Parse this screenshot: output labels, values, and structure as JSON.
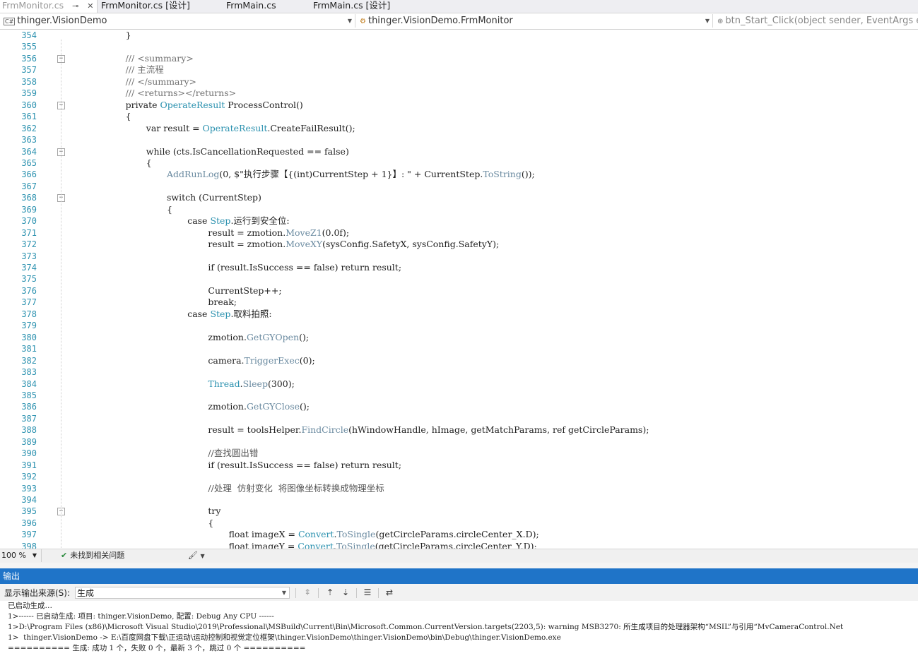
{
  "tabs": [
    {
      "label": "FrmMonitor.cs",
      "active": true
    },
    {
      "label": "FrmMonitor.cs [设计]",
      "active": false
    },
    {
      "label": "FrmMain.cs",
      "active": false
    },
    {
      "label": "FrmMain.cs [设计]",
      "active": false
    }
  ],
  "nav": {
    "project": "thinger.VisionDemo",
    "project_icon": "C#",
    "class_name": "thinger.VisionDemo.FrmMonitor",
    "member": "btn_Start_Click(object sender, EventArgs e)"
  },
  "editor": {
    "lines": [
      {
        "n": "354",
        "indent": 12,
        "segs": [
          [
            "}",
            "kw"
          ]
        ]
      },
      {
        "n": "355",
        "indent": 0,
        "segs": []
      },
      {
        "n": "356",
        "indent": 12,
        "segs": [
          [
            "/// <summary>",
            "cmt"
          ]
        ]
      },
      {
        "n": "357",
        "indent": 12,
        "segs": [
          [
            "/// 主流程",
            "cmt"
          ]
        ]
      },
      {
        "n": "358",
        "indent": 12,
        "segs": [
          [
            "/// </summary>",
            "cmt"
          ]
        ]
      },
      {
        "n": "359",
        "indent": 12,
        "segs": [
          [
            "/// <returns></returns>",
            "cmt"
          ]
        ]
      },
      {
        "n": "360",
        "indent": 12,
        "segs": [
          [
            "private ",
            "kw"
          ],
          [
            "OperateResult",
            "type"
          ],
          [
            " ProcessControl()",
            "kw"
          ]
        ]
      },
      {
        "n": "361",
        "indent": 12,
        "segs": [
          [
            "{",
            "kw"
          ]
        ]
      },
      {
        "n": "362",
        "indent": 16,
        "segs": [
          [
            "var result = ",
            "kw"
          ],
          [
            "OperateResult",
            "type"
          ],
          [
            ".CreateFailResult();",
            "kw"
          ]
        ]
      },
      {
        "n": "363",
        "indent": 0,
        "segs": []
      },
      {
        "n": "364",
        "indent": 16,
        "segs": [
          [
            "while (cts.IsCancellationRequested == false)",
            "kw"
          ]
        ]
      },
      {
        "n": "365",
        "indent": 16,
        "segs": [
          [
            "{",
            "kw"
          ]
        ]
      },
      {
        "n": "366",
        "indent": 20,
        "segs": [
          [
            "AddRunLog",
            "meth"
          ],
          [
            "(0, $\"执行步骤【{(int)CurrentStep + 1}】: \" + CurrentStep.",
            "kw"
          ],
          [
            "ToString",
            "meth"
          ],
          [
            "());",
            "kw"
          ]
        ]
      },
      {
        "n": "367",
        "indent": 0,
        "segs": []
      },
      {
        "n": "368",
        "indent": 20,
        "segs": [
          [
            "switch (CurrentStep)",
            "kw"
          ]
        ]
      },
      {
        "n": "369",
        "indent": 20,
        "segs": [
          [
            "{",
            "kw"
          ]
        ]
      },
      {
        "n": "370",
        "indent": 24,
        "segs": [
          [
            "case ",
            "kw"
          ],
          [
            "Step",
            "type"
          ],
          [
            ".运行到安全位:",
            "kw"
          ]
        ]
      },
      {
        "n": "371",
        "indent": 28,
        "segs": [
          [
            "result = zmotion.",
            "kw"
          ],
          [
            "MoveZ1",
            "meth"
          ],
          [
            "(0.0f);",
            "kw"
          ]
        ]
      },
      {
        "n": "372",
        "indent": 28,
        "segs": [
          [
            "result = zmotion.",
            "kw"
          ],
          [
            "MoveXY",
            "meth"
          ],
          [
            "(sysConfig.SafetyX, sysConfig.SafetyY);",
            "kw"
          ]
        ]
      },
      {
        "n": "373",
        "indent": 0,
        "segs": []
      },
      {
        "n": "374",
        "indent": 28,
        "segs": [
          [
            "if (result.IsSuccess == false) return result;",
            "kw"
          ]
        ]
      },
      {
        "n": "375",
        "indent": 0,
        "segs": []
      },
      {
        "n": "376",
        "indent": 28,
        "segs": [
          [
            "CurrentStep++;",
            "kw"
          ]
        ]
      },
      {
        "n": "377",
        "indent": 28,
        "segs": [
          [
            "break;",
            "kw"
          ]
        ]
      },
      {
        "n": "378",
        "indent": 24,
        "segs": [
          [
            "case ",
            "kw"
          ],
          [
            "Step",
            "type"
          ],
          [
            ".取料拍照:",
            "kw"
          ]
        ]
      },
      {
        "n": "379",
        "indent": 0,
        "segs": []
      },
      {
        "n": "380",
        "indent": 28,
        "segs": [
          [
            "zmotion.",
            "kw"
          ],
          [
            "GetGYOpen",
            "meth"
          ],
          [
            "();",
            "kw"
          ]
        ]
      },
      {
        "n": "381",
        "indent": 0,
        "segs": []
      },
      {
        "n": "382",
        "indent": 28,
        "segs": [
          [
            "camera.",
            "kw"
          ],
          [
            "TriggerExec",
            "meth"
          ],
          [
            "(0);",
            "kw"
          ]
        ]
      },
      {
        "n": "383",
        "indent": 0,
        "segs": []
      },
      {
        "n": "384",
        "indent": 28,
        "segs": [
          [
            "Thread",
            "type"
          ],
          [
            ".",
            "kw"
          ],
          [
            "Sleep",
            "meth"
          ],
          [
            "(300);",
            "kw"
          ]
        ]
      },
      {
        "n": "385",
        "indent": 0,
        "segs": []
      },
      {
        "n": "386",
        "indent": 28,
        "segs": [
          [
            "zmotion.",
            "kw"
          ],
          [
            "GetGYClose",
            "meth"
          ],
          [
            "();",
            "kw"
          ]
        ]
      },
      {
        "n": "387",
        "indent": 0,
        "segs": []
      },
      {
        "n": "388",
        "indent": 28,
        "segs": [
          [
            "result = toolsHelper.",
            "kw"
          ],
          [
            "FindCircle",
            "meth"
          ],
          [
            "(hWindowHandle, hImage, getMatchParams, ref getCircleParams);",
            "kw"
          ]
        ]
      },
      {
        "n": "389",
        "indent": 0,
        "segs": []
      },
      {
        "n": "390",
        "indent": 28,
        "segs": [
          [
            "//查找圆出错",
            "cmtg"
          ]
        ]
      },
      {
        "n": "391",
        "indent": 28,
        "segs": [
          [
            "if (result.IsSuccess == false) return result;",
            "kw"
          ]
        ]
      },
      {
        "n": "392",
        "indent": 0,
        "segs": []
      },
      {
        "n": "393",
        "indent": 28,
        "segs": [
          [
            "//处理  仿射变化  将图像坐标转换成物理坐标",
            "cmtg"
          ]
        ]
      },
      {
        "n": "394",
        "indent": 0,
        "segs": []
      },
      {
        "n": "395",
        "indent": 28,
        "segs": [
          [
            "try",
            "kw"
          ]
        ]
      },
      {
        "n": "396",
        "indent": 28,
        "segs": [
          [
            "{",
            "kw"
          ]
        ]
      },
      {
        "n": "397",
        "indent": 32,
        "segs": [
          [
            "float imageX = ",
            "kw"
          ],
          [
            "Convert",
            "type"
          ],
          [
            ".",
            "kw"
          ],
          [
            "ToSingle",
            "meth"
          ],
          [
            "(getCircleParams.circleCenter_X.D);",
            "kw"
          ]
        ]
      },
      {
        "n": "398",
        "indent": 32,
        "segs": [
          [
            "float imageY = ",
            "kw"
          ],
          [
            "Convert",
            "type"
          ],
          [
            ".",
            "kw"
          ],
          [
            "ToSingle",
            "meth"
          ],
          [
            "(getCircleParams.circleCenter_Y.D);",
            "kw"
          ]
        ]
      }
    ]
  },
  "status": {
    "zoom": "100 %",
    "issues": "未找到相关问题"
  },
  "output": {
    "title": "输出",
    "source_label": "显示输出来源(S):",
    "source_value": "生成",
    "lines": [
      "已启动生成…",
      "1>------ 已启动生成: 项目: thinger.VisionDemo, 配置: Debug Any CPU ------",
      "1>D:\\Program Files (x86)\\Microsoft Visual Studio\\2019\\Professional\\MSBuild\\Current\\Bin\\Microsoft.Common.CurrentVersion.targets(2203,5): warning MSB3270: 所生成项目的处理器架构“MSIL”与引用“MvCameraControl.Net",
      "1>  thinger.VisionDemo -> E:\\百度网盘下载\\正运动\\运动控制和视觉定位框架\\thinger.VisionDemo\\thinger.VisionDemo\\bin\\Debug\\thinger.VisionDemo.exe",
      "========== 生成: 成功 1 个，失败 0 个，最新 3 个，跳过 0 个 =========="
    ]
  },
  "colors": {
    "output_header": "#1f74c8",
    "line_number": "#2b91af",
    "type_name": "#2b91af"
  }
}
